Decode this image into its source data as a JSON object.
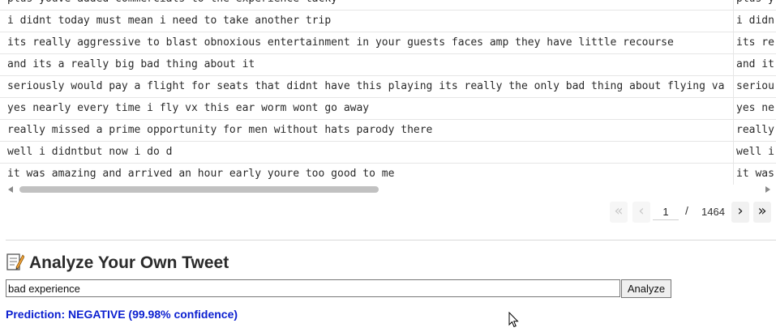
{
  "table": {
    "rows": [
      {
        "text": "plus youve added commercials to the experience tacky",
        "preprocessed": "plus y"
      },
      {
        "text": "i didnt today must mean i need to take another trip",
        "preprocessed": "i didn"
      },
      {
        "text": "its really aggressive to blast obnoxious entertainment in your guests faces amp they have little recourse",
        "preprocessed": "its re"
      },
      {
        "text": "and its a really big bad thing about it",
        "preprocessed": "and it"
      },
      {
        "text": "seriously would pay a flight for seats that didnt have this playing its really the only bad thing about flying va",
        "preprocessed": "seriou"
      },
      {
        "text": "yes nearly every time i fly vx this ear worm wont go away",
        "preprocessed": "yes ne"
      },
      {
        "text": "really missed a prime opportunity for men without hats parody there",
        "preprocessed": "really"
      },
      {
        "text": "well i didntbut now i do d",
        "preprocessed": "well i"
      },
      {
        "text": "it was amazing and arrived an hour early youre too good to me",
        "preprocessed": "it was"
      }
    ]
  },
  "pagination": {
    "first_label": "«",
    "prev_label": "‹",
    "current_page": "1",
    "separator": "/",
    "total_pages": "1464",
    "next_label": "›",
    "last_label": "»"
  },
  "analyze": {
    "icon": "memo-icon",
    "title": "Analyze Your Own Tweet",
    "input_value": "bad experience",
    "button_label": "Analyze",
    "prediction": "Prediction: NEGATIVE (99.98% confidence)",
    "prediction_color": "#0b1fd0"
  }
}
